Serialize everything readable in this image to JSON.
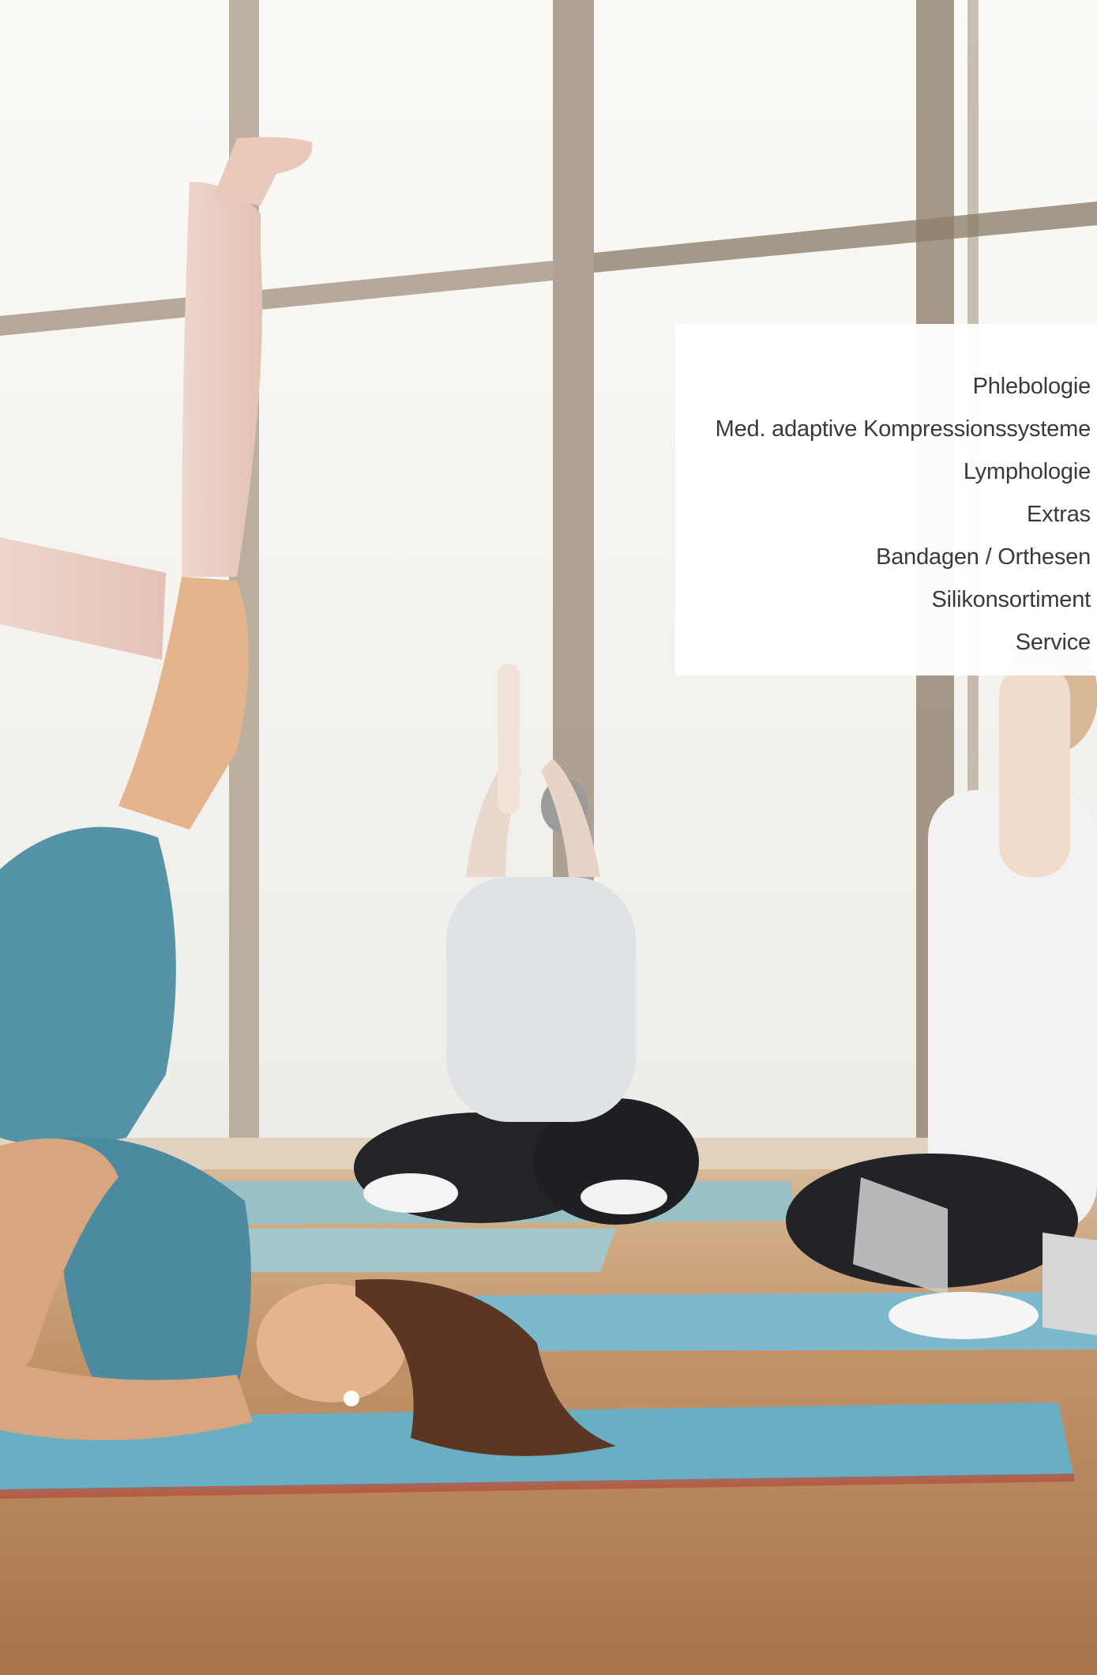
{
  "nav": {
    "items": [
      {
        "label": "Phlebologie"
      },
      {
        "label": "Med. adaptive Kompressionssysteme"
      },
      {
        "label": "Lymphologie"
      },
      {
        "label": "Extras"
      },
      {
        "label": "Bandagen / Orthesen"
      },
      {
        "label": "Silikonsortiment"
      },
      {
        "label": "Service"
      }
    ]
  },
  "colors": {
    "panel_background": "#ffffff",
    "nav_text": "#3a3a3a",
    "mat_blue": "#6fb1c4",
    "outfit_teal": "#4f8ea3",
    "floor_wood": "#b07b4f",
    "window_frame": "#8a7a6a"
  }
}
